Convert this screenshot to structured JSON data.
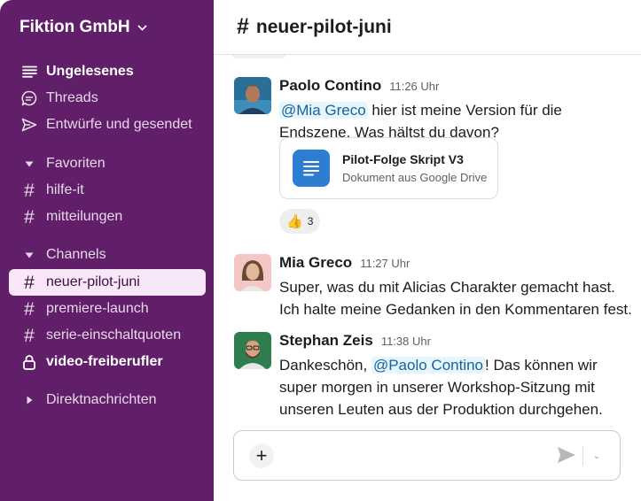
{
  "sidebar": {
    "workspace": "Fiktion GmbH",
    "items": [
      {
        "label": "Ungelesenes",
        "icon": "unread-list-icon"
      },
      {
        "label": "Threads",
        "icon": "threads-icon"
      },
      {
        "label": "Entwürfe und gesendet",
        "icon": "send-icon"
      }
    ],
    "favorites_label": "Favoriten",
    "favorites": [
      "hilfe-it",
      "mitteilungen"
    ],
    "channels_label": "Channels",
    "channels": [
      "neuer-pilot-juni",
      "premiere-launch",
      "serie-einschaltquoten",
      "video-freiberufler"
    ],
    "dm_label": "Direktnachrichten"
  },
  "header": {
    "hash": "#",
    "title": "neuer-pilot-juni"
  },
  "messages": [
    {
      "name": "Paolo Contino",
      "time": "11:26 Uhr",
      "mention": "@Mia Greco",
      "text": " hier ist meine Version für die Endszene. Was hältst du davon?",
      "attachment": {
        "title": "Pilot-Folge Skript V3",
        "subtitle": "Dokument aus Google Drive"
      },
      "reaction": {
        "emoji": "👍",
        "count": "3"
      }
    },
    {
      "name": "Mia Greco",
      "time": "11:27 Uhr",
      "text": "Super, was du mit Alicias Charakter gemacht hast. Ich halte meine Gedanken in den Kommentaren fest."
    },
    {
      "name": "Stephan Zeis",
      "time": "11:38 Uhr",
      "text_before": "Dankeschön, ",
      "mention": "@Paolo Contino",
      "text_after": "! Das können wir super morgen in unserer Workshop-Sitzung mit unseren Leuten aus der Produktion durchgehen."
    }
  ],
  "composer": {
    "plus": "+",
    "chevron": "⌄"
  },
  "colors": {
    "sidebar_bg": "#611f69",
    "active_item_bg": "#f8e7f8",
    "mention_text": "#1264a3",
    "doc_icon": "#2d7dd2"
  }
}
